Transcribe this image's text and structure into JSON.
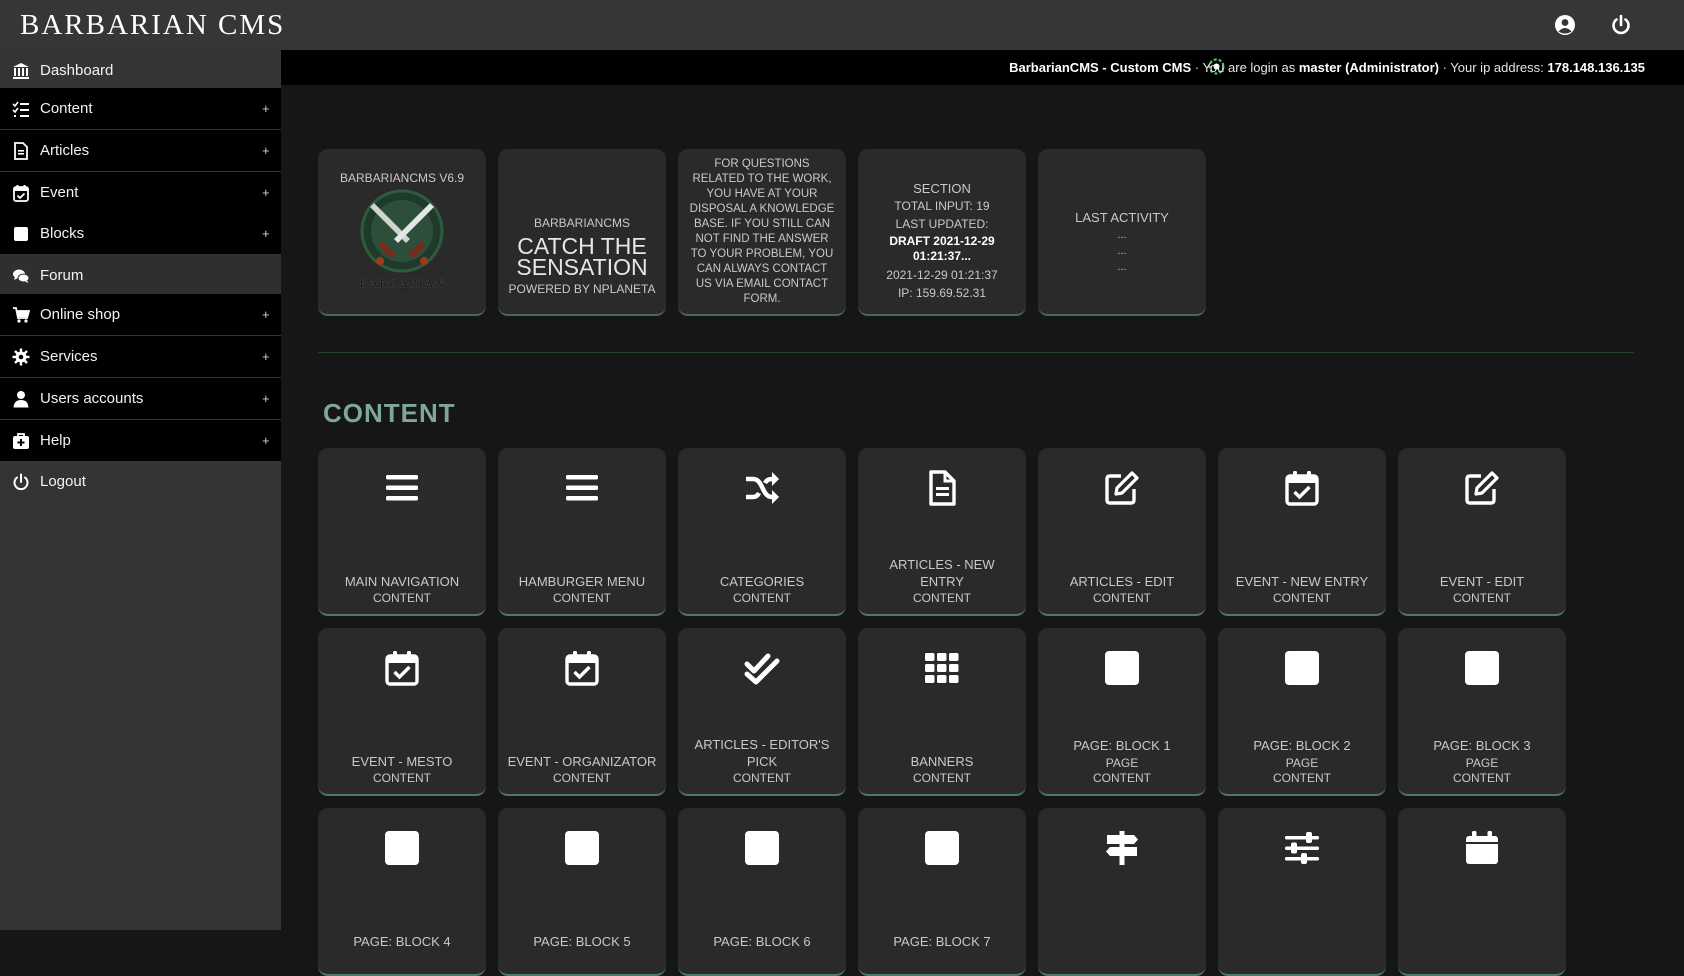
{
  "app": {
    "logo_text": "BARBARIAN CMS"
  },
  "sidebar": {
    "items": [
      {
        "label": "Dashboard",
        "icon": "bank-icon",
        "expandable": false
      },
      {
        "label": "Content",
        "icon": "list-check-icon",
        "expandable": true
      },
      {
        "label": "Articles",
        "icon": "document-icon",
        "expandable": true
      },
      {
        "label": "Event",
        "icon": "calendar-check-icon",
        "expandable": true
      },
      {
        "label": "Blocks",
        "icon": "square-icon",
        "expandable": true
      },
      {
        "label": "Forum",
        "icon": "comments-icon",
        "expandable": false
      },
      {
        "label": "Online shop",
        "icon": "cart-icon",
        "expandable": true
      },
      {
        "label": "Services",
        "icon": "gear-icon",
        "expandable": true
      },
      {
        "label": "Users accounts",
        "icon": "user-icon",
        "expandable": true
      },
      {
        "label": "Help",
        "icon": "first-aid-icon",
        "expandable": true
      },
      {
        "label": "Logout",
        "icon": "power-icon",
        "expandable": false
      }
    ],
    "plus_symbol": "+"
  },
  "status": {
    "app_name": "BarbarianCMS - Custom CMS",
    "login_prefix": " · You are login as ",
    "user": "master (Administrator)",
    "ip_prefix": " · Your ip address: ",
    "ip": "178.148.136.135"
  },
  "info_cards": {
    "version": {
      "title": "BARBARIANCMS V6.9",
      "logo_word": "BARBARIAN",
      "logo_small": "CMS"
    },
    "slogan": {
      "top": "BARBARIANCMS",
      "big": "CATCH THE SENSATION",
      "bottom": "POWERED BY NPLANETA"
    },
    "help": {
      "text": "FOR QUESTIONS RELATED TO THE WORK, YOU HAVE AT YOUR DISPOSAL A KNOWLEDGE BASE. IF YOU STILL CAN NOT FIND THE ANSWER TO YOUR PROBLEM, YOU CAN ALWAYS CONTACT US VIA EMAIL CONTACT FORM."
    },
    "section": {
      "title": "SECTION",
      "total": "TOTAL INPUT: 19",
      "updated_label": "LAST UPDATED:",
      "draft": "DRAFT 2021-12-29 01:21:37...",
      "date": "2021-12-29 01:21:37",
      "ip": "IP: 159.69.52.31"
    },
    "activity": {
      "title": "LAST ACTIVITY",
      "lines": [
        "...",
        "...",
        "..."
      ]
    }
  },
  "content": {
    "title": "CONTENT",
    "tiles": [
      {
        "label": "MAIN NAVIGATION",
        "sub": "CONTENT",
        "icon": "bars-icon"
      },
      {
        "label": "HAMBURGER MENU",
        "sub": "CONTENT",
        "icon": "bars-icon"
      },
      {
        "label": "CATEGORIES",
        "sub": "CONTENT",
        "icon": "shuffle-icon"
      },
      {
        "label": "ARTICLES - NEW ENTRY",
        "sub": "CONTENT",
        "icon": "file-lines-icon"
      },
      {
        "label": "ARTICLES - EDIT",
        "sub": "CONTENT",
        "icon": "edit-icon"
      },
      {
        "label": "EVENT - NEW ENTRY",
        "sub": "CONTENT",
        "icon": "calendar-check-icon"
      },
      {
        "label": "EVENT - EDIT",
        "sub": "CONTENT",
        "icon": "edit-icon"
      },
      {
        "label": "EVENT - MESTO",
        "sub": "CONTENT",
        "icon": "calendar-check-icon"
      },
      {
        "label": "EVENT - ORGANIZATOR",
        "sub": "CONTENT",
        "icon": "calendar-check-icon"
      },
      {
        "label": "ARTICLES - EDITOR'S PICK",
        "sub": "CONTENT",
        "icon": "double-check-icon"
      },
      {
        "label": "BANNERS",
        "sub": "CONTENT",
        "icon": "grid-icon"
      },
      {
        "label": "PAGE: BLOCK 1",
        "sub": "PAGE CONTENT",
        "icon": "square-icon"
      },
      {
        "label": "PAGE: BLOCK 2",
        "sub": "PAGE CONTENT",
        "icon": "square-icon"
      },
      {
        "label": "PAGE: BLOCK 3",
        "sub": "PAGE CONTENT",
        "icon": "square-icon"
      },
      {
        "label": "PAGE: BLOCK 4",
        "sub": "",
        "icon": "square-icon"
      },
      {
        "label": "PAGE: BLOCK 5",
        "sub": "",
        "icon": "square-icon"
      },
      {
        "label": "PAGE: BLOCK 6",
        "sub": "",
        "icon": "square-icon"
      },
      {
        "label": "PAGE: BLOCK 7",
        "sub": "",
        "icon": "square-icon"
      },
      {
        "label": "",
        "sub": "",
        "icon": "signs-icon"
      },
      {
        "label": "",
        "sub": "",
        "icon": "sliders-icon"
      },
      {
        "label": "",
        "sub": "",
        "icon": "calendar-icon"
      }
    ]
  },
  "colors": {
    "topbar": "#363636",
    "sidebar": "#343434",
    "accent_green": "#7fa796",
    "tile_bg": "#2a2a2a"
  }
}
